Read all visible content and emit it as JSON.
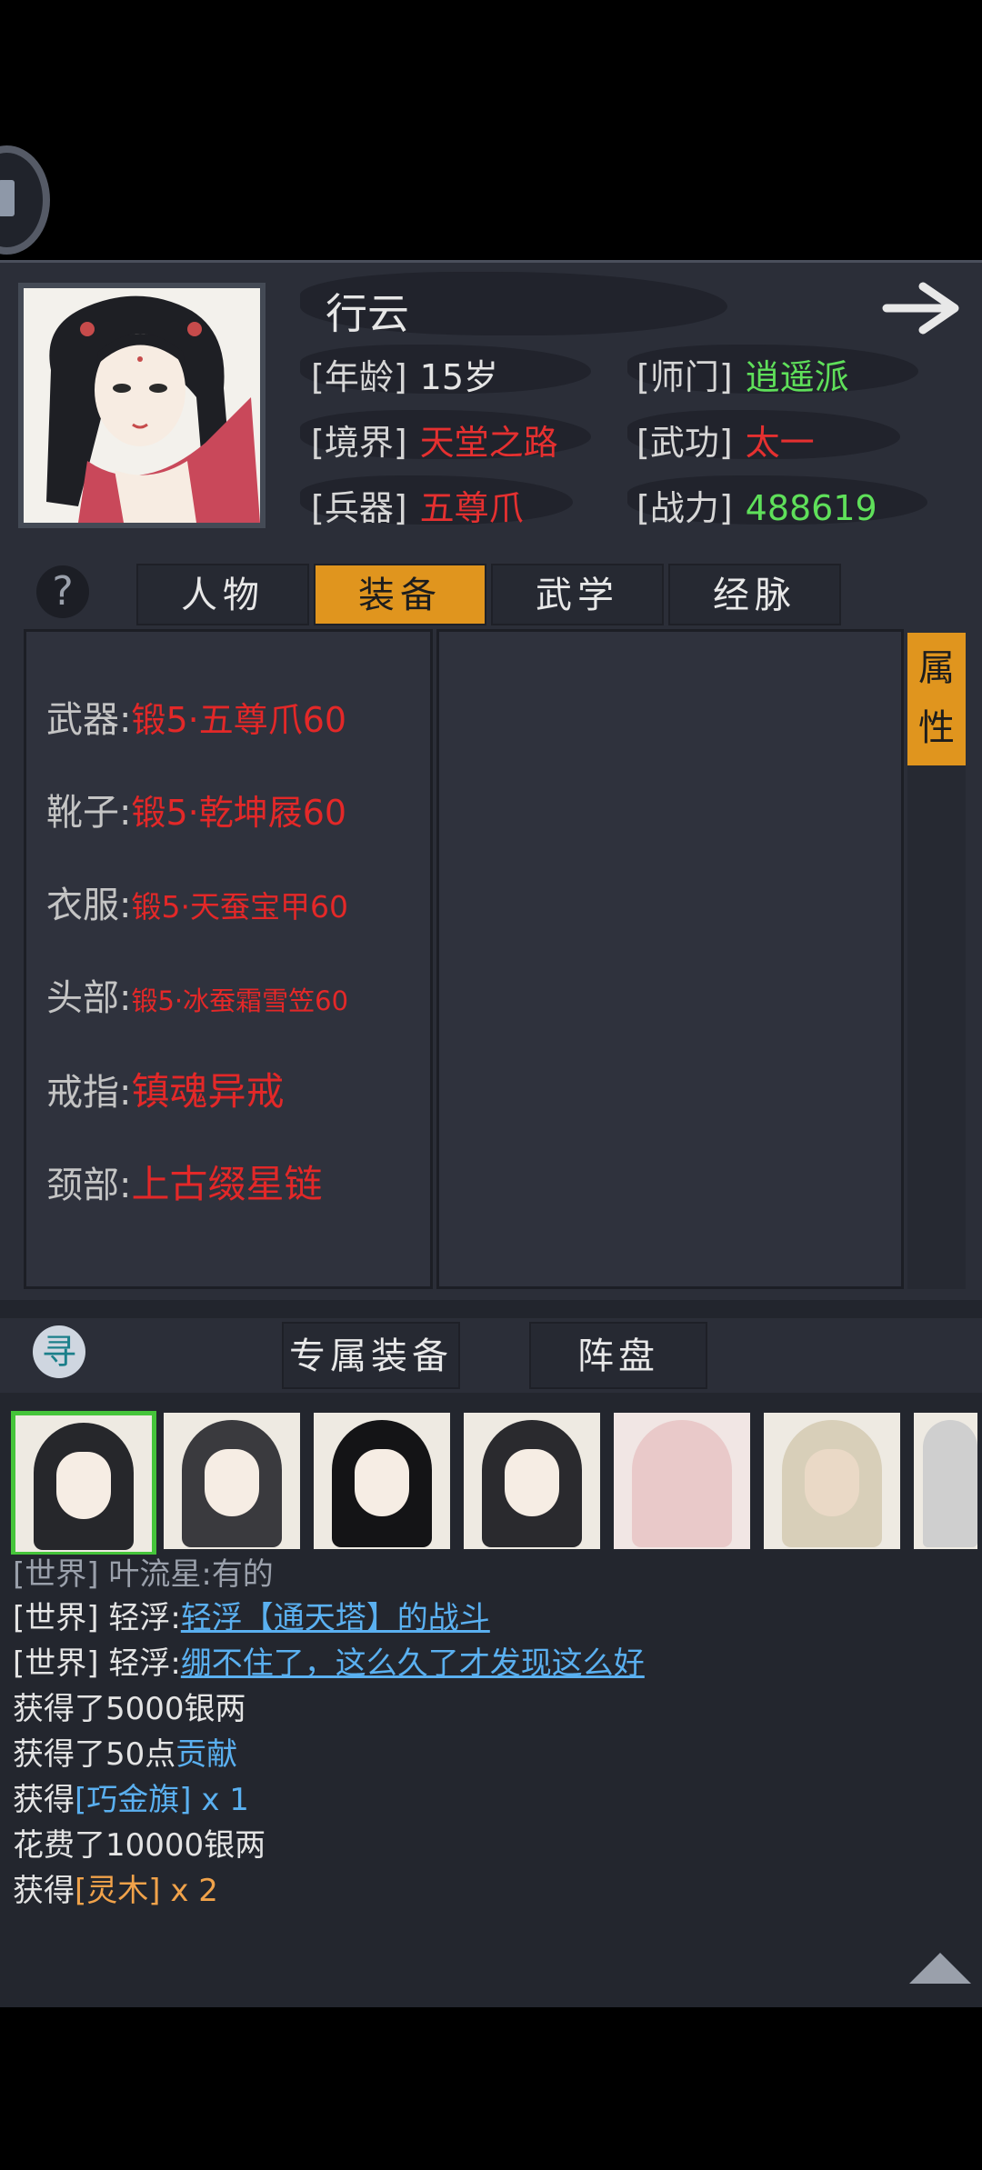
{
  "character": {
    "name": "行云",
    "age_label": "[年龄]",
    "age_value": "15岁",
    "realm_label": "[境界]",
    "realm_value": "天堂之路",
    "weapon_label": "[兵器]",
    "weapon_value": "五尊爪",
    "sect_label": "[师门]",
    "sect_value": "逍遥派",
    "skill_label": "[武功]",
    "skill_value": "太一",
    "power_label": "[战力]",
    "power_value": "488619"
  },
  "tabs": [
    {
      "label": "人物",
      "active": false
    },
    {
      "label": "装备",
      "active": true
    },
    {
      "label": "武学",
      "active": false
    },
    {
      "label": "经脉",
      "active": false
    }
  ],
  "help_label": "?",
  "attr_button": [
    "属",
    "性"
  ],
  "equipment": [
    {
      "slot": "武器:",
      "item": "锻5·五尊爪60"
    },
    {
      "slot": "靴子:",
      "item": "锻5·乾坤屐60"
    },
    {
      "slot": "衣服:",
      "item": "锻5·天蚕宝甲60"
    },
    {
      "slot": "头部:",
      "item": "锻5·冰蚕霜雪笠60"
    },
    {
      "slot": "戒指:",
      "item": "镇魂异戒"
    },
    {
      "slot": "颈部:",
      "item": "上古缀星链"
    }
  ],
  "buttons": {
    "exclusive_equip": "专属装备",
    "formation": "阵盘",
    "swirl_glyph": "寻"
  },
  "chat": {
    "line0": {
      "channel": "[世界]",
      "sender": "叶流星:",
      "msg": "有的"
    },
    "line1": {
      "channel": "[世界]",
      "sender": "轻浮:",
      "msg": "轻浮【通天塔】的战斗"
    },
    "line2": {
      "channel": "[世界]",
      "sender": "轻浮:",
      "msg": "绷不住了，这么久了才发现这么好"
    },
    "line3": "获得了5000银两",
    "line4_pre": "获得了50点",
    "line4_link": "贡献",
    "line5_pre": "获得",
    "line5_item": "[巧金旗]",
    "line5_qty": "x 1",
    "line6": "花费了10000银两",
    "line7_pre": "获得",
    "line7_item": "[灵木]",
    "line7_qty": "x 2"
  },
  "colors": {
    "accent": "#e0951e",
    "red_value": "#e53030",
    "green_value": "#5fe05a",
    "link_blue": "#5ab0f0",
    "item_orange": "#f0a24a"
  },
  "icons": {
    "next": "arrow-right-icon",
    "help": "question-icon",
    "scroll": "triangle-up-icon"
  }
}
